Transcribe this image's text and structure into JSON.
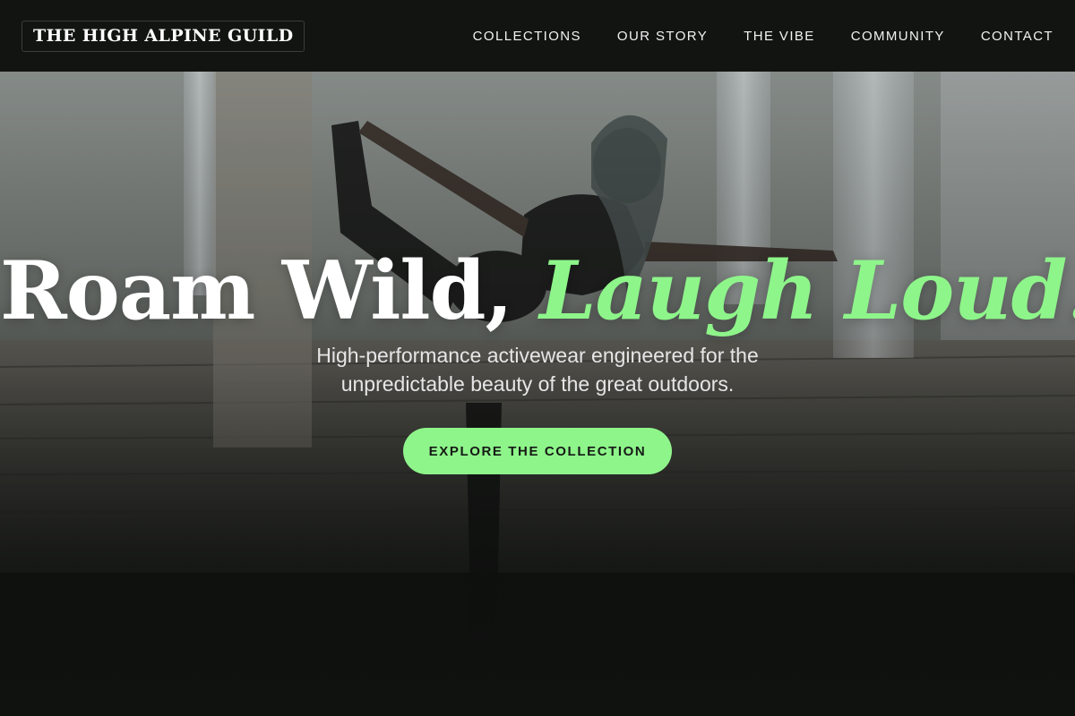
{
  "header": {
    "logo_text": "THE HIGH ALPINE GUILD",
    "nav": [
      {
        "label": "COLLECTIONS"
      },
      {
        "label": "OUR STORY"
      },
      {
        "label": "THE VIBE"
      },
      {
        "label": "COMMUNITY"
      },
      {
        "label": "CONTACT"
      }
    ]
  },
  "hero": {
    "headline_plain": "Roam Wild,",
    "headline_accent": "Laugh Loud.",
    "subtitle_line1": "High-performance activewear engineered for the",
    "subtitle_line2": "unpredictable beauty of the great outdoors.",
    "cta_label": "EXPLORE THE COLLECTION"
  },
  "colors": {
    "accent": "#8ef58a",
    "header_bg": "#121412",
    "text_light": "#ffffff"
  }
}
